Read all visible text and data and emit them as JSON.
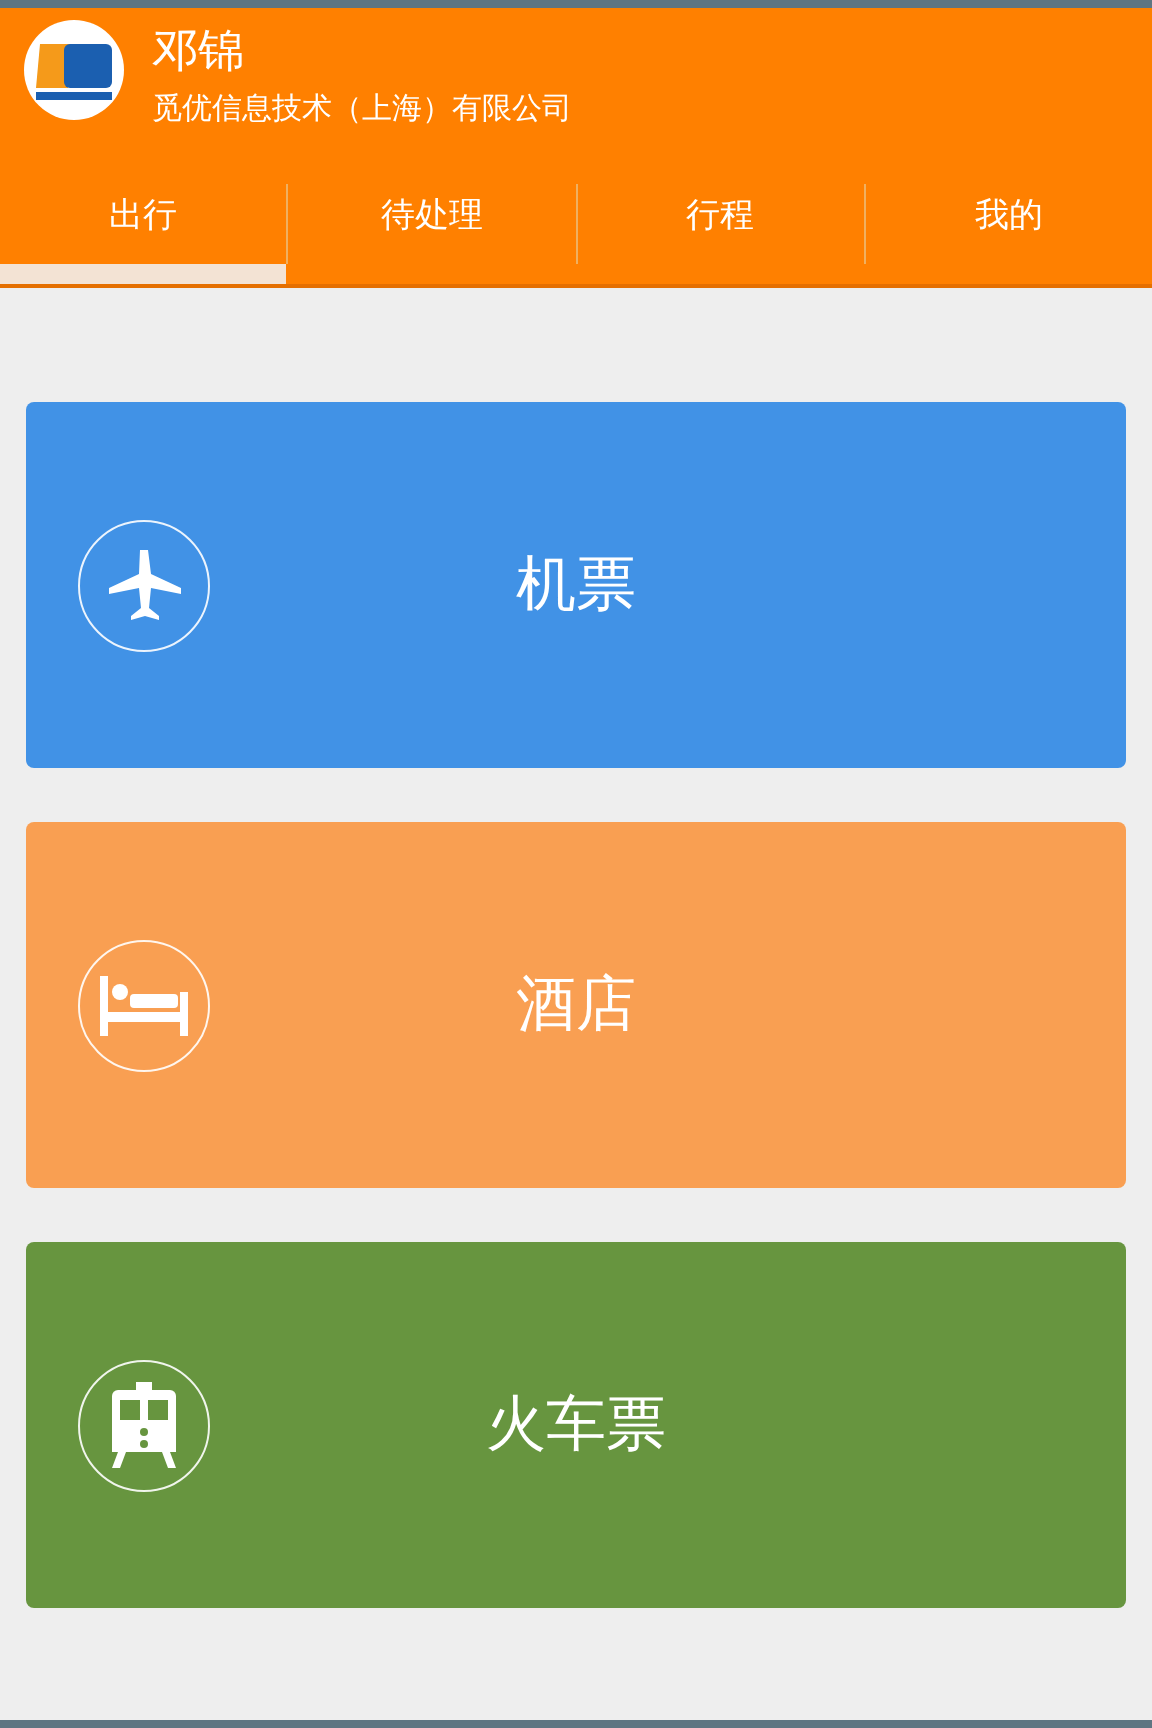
{
  "header": {
    "name": "邓锦",
    "company": "觅优信息技术（上海）有限公司"
  },
  "tabs": [
    {
      "label": "出行",
      "selected": true
    },
    {
      "label": "待处理",
      "selected": false
    },
    {
      "label": "行程",
      "selected": false
    },
    {
      "label": "我的",
      "selected": false
    }
  ],
  "services": [
    {
      "kind": "plane",
      "label": "机票",
      "color": "#4192e6"
    },
    {
      "kind": "bed",
      "label": "酒店",
      "color": "#f99f52"
    },
    {
      "kind": "train",
      "label": "火车票",
      "color": "#67953f"
    }
  ]
}
